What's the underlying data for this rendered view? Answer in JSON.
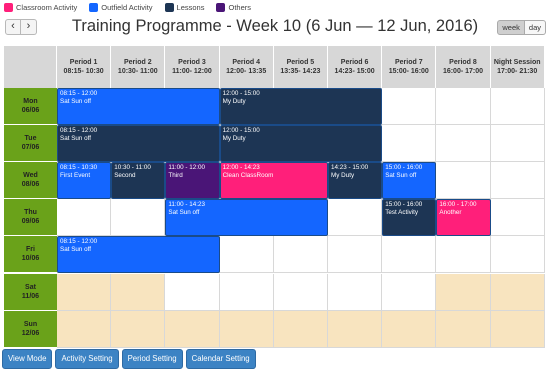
{
  "legend": [
    {
      "label": "Classroom Activity",
      "color": "#ff1f7a"
    },
    {
      "label": "Outfield Activity",
      "color": "#1466ff"
    },
    {
      "label": "Lessons",
      "color": "#1d3554"
    },
    {
      "label": "Others",
      "color": "#4a1577"
    }
  ],
  "nav": {
    "prev": "‹",
    "next": "›"
  },
  "title": "Training Programme - Week 10 (6 Jun — 12 Jun, 2016)",
  "views": {
    "week": "week",
    "day": "day"
  },
  "periods": [
    {
      "name": "Period 1",
      "time": "08:15- 10:30"
    },
    {
      "name": "Period 2",
      "time": "10:30- 11:00"
    },
    {
      "name": "Period 3",
      "time": "11:00- 12:00"
    },
    {
      "name": "Period 4",
      "time": "12:00- 13:35"
    },
    {
      "name": "Period 5",
      "time": "13:35- 14:23"
    },
    {
      "name": "Period 6",
      "time": "14:23- 15:00"
    },
    {
      "name": "Period 7",
      "time": "15:00- 16:00"
    },
    {
      "name": "Period 8",
      "time": "16:00- 17:00"
    },
    {
      "name": "Night Session",
      "time": "17:00- 21:30"
    }
  ],
  "days": [
    {
      "name": "Mon",
      "date": "06/06"
    },
    {
      "name": "Tue",
      "date": "07/06"
    },
    {
      "name": "Wed",
      "date": "08/06"
    },
    {
      "name": "Thu",
      "date": "09/06"
    },
    {
      "name": "Fri",
      "date": "10/06"
    },
    {
      "name": "Sat",
      "date": "11/06"
    },
    {
      "name": "Sun",
      "date": "12/06"
    }
  ],
  "events": [
    {
      "day": 0,
      "start": 0,
      "span": 3,
      "time": "08:15 - 12:00",
      "title": "Sat Sun off",
      "type": "outfield"
    },
    {
      "day": 0,
      "start": 3,
      "span": 3,
      "time": "12:00 - 15:00",
      "title": "My Duty",
      "type": "lesson"
    },
    {
      "day": 1,
      "start": 0,
      "span": 3,
      "time": "08:15 - 12:00",
      "title": "Sat Sun off",
      "type": "lesson"
    },
    {
      "day": 1,
      "start": 3,
      "span": 3,
      "time": "12:00 - 15:00",
      "title": "My Duty",
      "type": "lesson"
    },
    {
      "day": 2,
      "start": 0,
      "span": 1,
      "time": "08:15 - 10:30",
      "title": "First Event",
      "type": "outfield"
    },
    {
      "day": 2,
      "start": 1,
      "span": 1,
      "time": "10:30 - 11:00",
      "title": "Second",
      "type": "lesson"
    },
    {
      "day": 2,
      "start": 2,
      "span": 1,
      "time": "11:00 - 12:00",
      "title": "Third",
      "type": "other"
    },
    {
      "day": 2,
      "start": 3,
      "span": 2,
      "time": "12:00 - 14:23",
      "title": "Clean ClassRoom",
      "type": "classroom"
    },
    {
      "day": 2,
      "start": 5,
      "span": 1,
      "time": "14:23 - 15:00",
      "title": "My Duty",
      "type": "lesson"
    },
    {
      "day": 2,
      "start": 6,
      "span": 1,
      "time": "15:00 - 16:00",
      "title": "Sat Sun off",
      "type": "outfield"
    },
    {
      "day": 3,
      "start": 2,
      "span": 3,
      "time": "11:00 - 14:23",
      "title": "Sat Sun off",
      "type": "outfield"
    },
    {
      "day": 3,
      "start": 6,
      "span": 1,
      "time": "15:00 - 16:00",
      "title": "Test Activity",
      "type": "lesson"
    },
    {
      "day": 3,
      "start": 7,
      "span": 1,
      "time": "16:00 - 17:00",
      "title": "Another",
      "type": "classroom"
    },
    {
      "day": 4,
      "start": 0,
      "span": 3,
      "time": "08:15 - 12:00",
      "title": "Sat Sun off",
      "type": "outfield"
    }
  ],
  "footer": {
    "view_mode": "View Mode",
    "activity_setting": "Activity Setting",
    "period_setting": "Period Setting",
    "calendar_setting": "Calendar Setting"
  }
}
